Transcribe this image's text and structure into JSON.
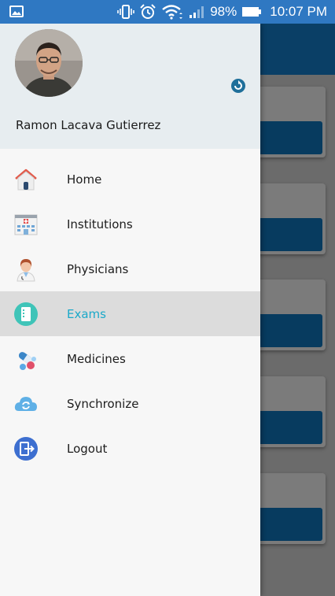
{
  "status_bar": {
    "battery": "98%",
    "time": "10:07 PM"
  },
  "drawer": {
    "user_name": "Ramon Lacava Gutierrez",
    "items": [
      {
        "label": "Home",
        "icon": "home-icon"
      },
      {
        "label": "Institutions",
        "icon": "hospital-icon"
      },
      {
        "label": "Physicians",
        "icon": "doctor-icon"
      },
      {
        "label": "Exams",
        "icon": "exam-icon",
        "active": true
      },
      {
        "label": "Medicines",
        "icon": "pills-icon"
      },
      {
        "label": "Synchronize",
        "icon": "cloud-sync-icon"
      },
      {
        "label": "Logout",
        "icon": "logout-icon"
      }
    ]
  },
  "colors": {
    "status_bar": "#2f78c2",
    "header_bg": "#e7edf0",
    "active_label": "#1ba9c9",
    "active_bg": "#dcdcdc"
  }
}
